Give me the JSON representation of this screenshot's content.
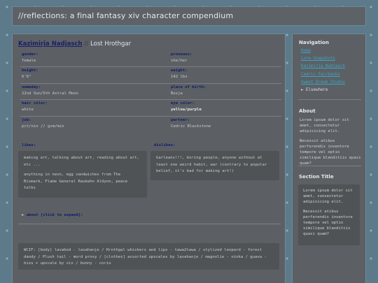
{
  "site": {
    "title": "//reflections: a final fantasy xiv character compendium"
  },
  "character": {
    "name": "Kazimirja Nadjasch",
    "separator": "//",
    "subtitle": "Lost Hrothgar"
  },
  "info": [
    {
      "left": {
        "label": "gender:",
        "value": "female"
      },
      "right": {
        "label": "pronouns:",
        "value": "she/her"
      }
    },
    {
      "left": {
        "label": "height:",
        "value": "6'6\""
      },
      "right": {
        "label": "weight:",
        "value": "142 lbs"
      }
    },
    {
      "left": {
        "label": "nameday:",
        "value": "22nd Sun/5th Astral Moon"
      },
      "right": {
        "label": "place of birth:",
        "value": "Bozja"
      }
    },
    {
      "left": {
        "label": "hair color:",
        "value": "white"
      },
      "right": {
        "label": "eye color:",
        "value": "yellow/purple"
      }
    },
    {
      "left": {
        "label": "job:",
        "value": "pct/nin // gsm/min"
      },
      "right": {
        "label": "partner:",
        "value": "Cedric Blackstone"
      }
    }
  ],
  "likes": {
    "label": "likes:",
    "paragraphs": [
      "making art, talking about art, reading about art, etc ...",
      "anything in neon, egg sandwiches from The Bismark, Flame General Raubahn Aldynn, peace talks"
    ]
  },
  "dislikes": {
    "label": "dislikes:",
    "text": "Garleans!!!, boring people, anyone without at least one weird habit, war (contrary to popular belief, it's bad for making art!)"
  },
  "about": {
    "arrow": "►",
    "label": "about [click to expand]:"
  },
  "wcif": {
    "text": "WCIF: [body] lavabod - lavahanje / Hrothgal whiskers and lips - tawa2tawa / stylized leopard - forest dandy / Plush tail - mord proxy / [clothes] assorted upscales by lavahanje / magnolie - ninka / guava - bizu + upscale by six / bunny - corio"
  },
  "sidebar": {
    "nav_title": "Navigation",
    "nav_links": [
      "Home",
      "Lore Snapshots",
      "Kazimirja Nadjasch",
      "Cedric Fairbanks",
      "Sweet Dream Studio"
    ],
    "elsewhere_arrow": "►",
    "elsewhere_label": "Elsewhere",
    "about_title": "About",
    "about_paragraphs": [
      "Lorem ipsum dolor sit amet, consectetur adipisicing elit.",
      "Necessit atibus perferendis inventore tempore vel optio similique blanditiis quasi quam?"
    ],
    "section_title": "Section Title",
    "section_paragraphs": [
      "Lorem ipsum dolor sit amet, consectetur adipisicing elit.",
      "Necessit atibus perferendis inventore tempore vel optio similique blanditiis quasi quam?"
    ]
  }
}
